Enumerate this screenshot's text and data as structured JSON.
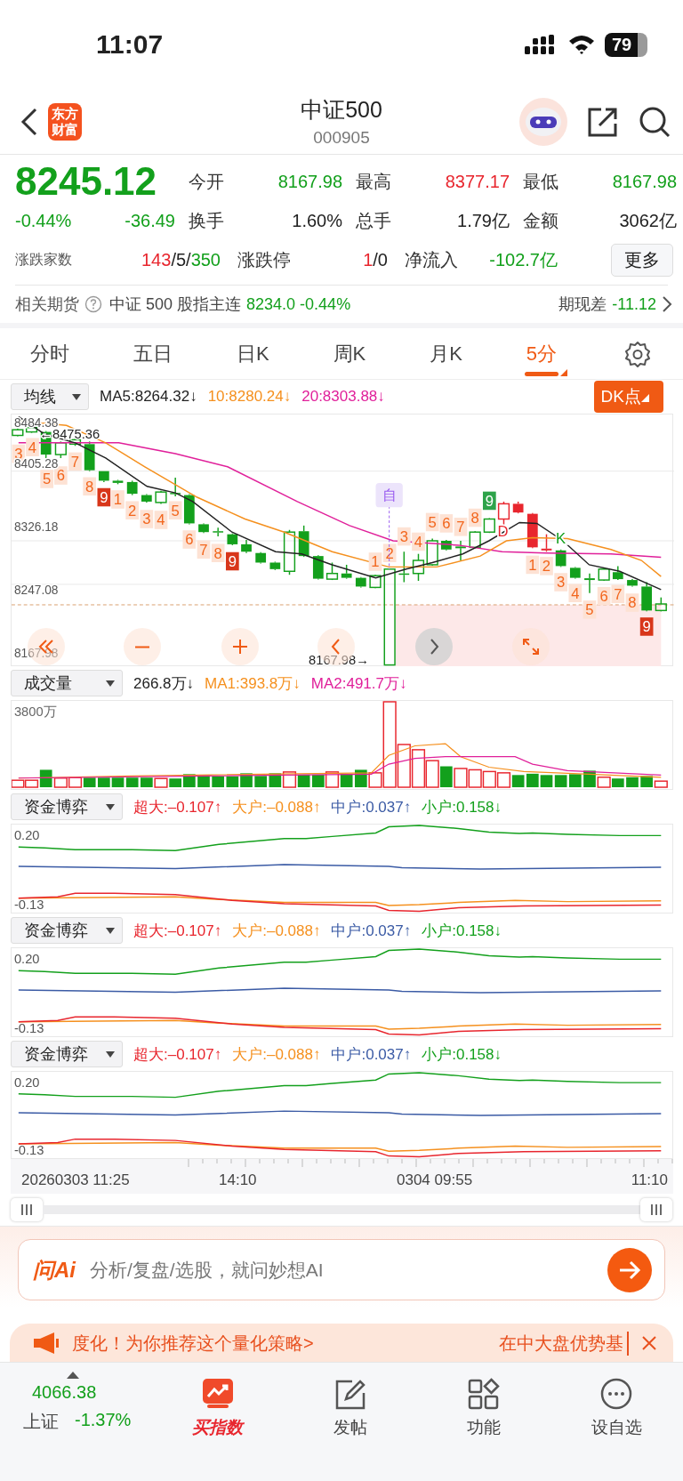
{
  "status_bar": {
    "time": "11:07",
    "battery": "79"
  },
  "header": {
    "logo": "东方财富",
    "title": "中证500",
    "code": "000905"
  },
  "quote": {
    "price": "8245.12",
    "change_percent": "-0.44%",
    "change": "-36.49",
    "color": "#13a01c",
    "stats": [
      {
        "label": "今开",
        "value": "8167.98",
        "color": "#13a01c"
      },
      {
        "label": "最高",
        "value": "8377.17",
        "color": "#e8262e"
      },
      {
        "label": "最低",
        "value": "8167.98",
        "color": "#13a01c"
      },
      {
        "label": "换手",
        "value": "1.60%",
        "color": "#222222"
      },
      {
        "label": "总手",
        "value": "1.79亿",
        "color": "#222222"
      },
      {
        "label": "金额",
        "value": "3062亿",
        "color": "#222222"
      }
    ],
    "breadth": {
      "label": "涨跌家数",
      "parts": [
        {
          "text": "143",
          "color": "#e8262e"
        },
        {
          "text": "/5/",
          "color": "#222222"
        },
        {
          "text": "350",
          "color": "#13a01c"
        }
      ]
    },
    "limit": {
      "label": "涨跌停",
      "parts": [
        {
          "text": "1",
          "color": "#e8262e"
        },
        {
          "text": "/0",
          "color": "#222222"
        }
      ]
    },
    "net_inflow": {
      "label": "净流入",
      "value": "-102.7亿",
      "color": "#13a01c"
    },
    "more_button": "更多"
  },
  "futures": {
    "label": "相关期货",
    "name": "中证 500 股指主连",
    "quote": "8234.0 -0.44%",
    "spread_label": "期现差",
    "spread": "-11.12"
  },
  "period_tabs": [
    {
      "label": "分时",
      "selected": false
    },
    {
      "label": "五日",
      "selected": false
    },
    {
      "label": "日K",
      "selected": false
    },
    {
      "label": "周K",
      "selected": false
    },
    {
      "label": "月K",
      "selected": false
    },
    {
      "label": "5分",
      "selected": true
    }
  ],
  "price_chart": {
    "indicator": "均线",
    "legend": [
      {
        "text": "MA5:8264.32↓",
        "color": "#222222"
      },
      {
        "text": "10:8280.24↓",
        "color": "#f5901e"
      },
      {
        "text": "20:8303.88↓",
        "color": "#e0209a"
      }
    ],
    "dk_button": "DK点",
    "axis_labels": [
      "8484.38",
      "8405.28",
      "8326.18",
      "8247.08",
      "8167.98"
    ],
    "high_mark": "←8475.36",
    "low_mark": "8167.98→",
    "marker": "自",
    "sequence": [
      {
        "text": "3",
        "kind": "plain"
      },
      {
        "text": "4",
        "kind": "plain"
      },
      {
        "text": "5",
        "kind": "plain"
      },
      {
        "text": "6",
        "kind": "plain"
      },
      {
        "text": "7",
        "kind": "plain"
      },
      {
        "text": "8",
        "kind": "plain"
      },
      {
        "text": "9",
        "kind": "dark"
      },
      {
        "text": "1",
        "kind": "plain"
      },
      {
        "text": "2",
        "kind": "plain"
      },
      {
        "text": "3",
        "kind": "plain"
      },
      {
        "text": "4",
        "kind": "plain"
      },
      {
        "text": "5",
        "kind": "plain"
      },
      {
        "text": "6",
        "kind": "plain"
      },
      {
        "text": "7",
        "kind": "plain"
      },
      {
        "text": "8",
        "kind": "plain"
      },
      {
        "text": "9",
        "kind": "dark"
      },
      {
        "text": "1",
        "kind": "plain"
      },
      {
        "text": "2",
        "kind": "plain"
      },
      {
        "text": "3",
        "kind": "plain"
      },
      {
        "text": "4",
        "kind": "plain"
      },
      {
        "text": "5",
        "kind": "plain"
      },
      {
        "text": "6",
        "kind": "plain"
      },
      {
        "text": "7",
        "kind": "plain"
      },
      {
        "text": "8",
        "kind": "plain"
      },
      {
        "text": "9",
        "kind": "badge_green"
      },
      {
        "text": "D",
        "kind": "letter_red"
      },
      {
        "text": "1",
        "kind": "plain"
      },
      {
        "text": "2",
        "kind": "plain"
      },
      {
        "text": "K",
        "kind": "letter_green"
      },
      {
        "text": "3",
        "kind": "plain"
      },
      {
        "text": "4",
        "kind": "plain"
      },
      {
        "text": "5",
        "kind": "plain"
      },
      {
        "text": "6",
        "kind": "plain"
      },
      {
        "text": "7",
        "kind": "plain"
      },
      {
        "text": "8",
        "kind": "plain"
      },
      {
        "text": "9",
        "kind": "dark"
      }
    ]
  },
  "volume_chart": {
    "indicator": "成交量",
    "legend": [
      {
        "text": "266.8万↓",
        "color": "#222222"
      },
      {
        "text": "MA1:393.8万↓",
        "color": "#f5901e"
      },
      {
        "text": "MA2:491.7万↓",
        "color": "#e0209a"
      }
    ],
    "axis_label": "3800万"
  },
  "fund_panels": [
    {
      "indicator": "资金博弈",
      "legend": [
        {
          "text": "超大:–0.107↑",
          "color": "#e8262e"
        },
        {
          "text": "大户:–0.088↑",
          "color": "#f5901e"
        },
        {
          "text": "中户:0.037↑",
          "color": "#3b5ba5"
        },
        {
          "text": "小户:0.158↓",
          "color": "#13a01c"
        }
      ],
      "axis_labels": [
        "0.20",
        "-0.13"
      ]
    },
    {
      "indicator": "资金博弈",
      "legend": [
        {
          "text": "超大:–0.107↑",
          "color": "#e8262e"
        },
        {
          "text": "大户:–0.088↑",
          "color": "#f5901e"
        },
        {
          "text": "中户:0.037↑",
          "color": "#3b5ba5"
        },
        {
          "text": "小户:0.158↓",
          "color": "#13a01c"
        }
      ],
      "axis_labels": [
        "0.20",
        "-0.13"
      ]
    },
    {
      "indicator": "资金博弈",
      "legend": [
        {
          "text": "超大:–0.107↑",
          "color": "#e8262e"
        },
        {
          "text": "大户:–0.088↑",
          "color": "#f5901e"
        },
        {
          "text": "中户:0.037↑",
          "color": "#3b5ba5"
        },
        {
          "text": "小户:0.158↓",
          "color": "#13a01c"
        }
      ],
      "axis_labels": [
        "0.20",
        "-0.13"
      ]
    }
  ],
  "time_axis": [
    "20260303 11:25",
    "14:10",
    "0304 09:55",
    "11:10"
  ],
  "ai_bar": {
    "logo": "问Ai",
    "placeholder": "分析/复盘/选股，就问妙想AI"
  },
  "banner": {
    "text": "度化！为你推荐这个量化策略>",
    "ticker": "在中大盘优势基"
  },
  "bottom_nav": {
    "index": {
      "value": "4066.38",
      "name": "上证",
      "change": "-1.37%",
      "color": "#13a01c"
    },
    "tabs": [
      {
        "label": "买指数",
        "kind": "promo"
      },
      {
        "label": "发帖",
        "kind": "post"
      },
      {
        "label": "功能",
        "kind": "apps"
      },
      {
        "label": "设自选",
        "kind": "more"
      }
    ]
  }
}
